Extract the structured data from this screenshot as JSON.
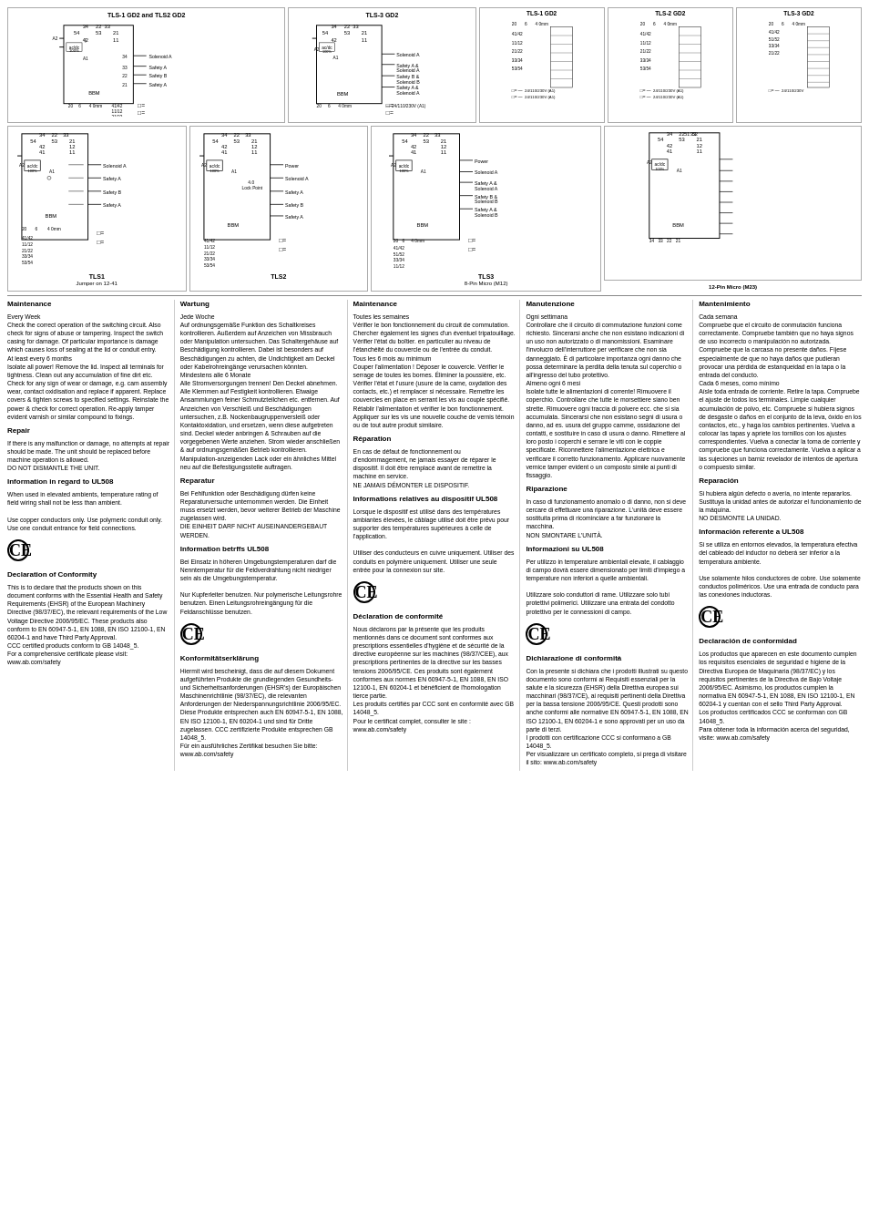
{
  "diagrams": {
    "row1": [
      {
        "label": "TLS-1 GD2 and TLS2 GD2",
        "subtitle": ""
      },
      {
        "label": "TLS-3 GD2",
        "subtitle": ""
      },
      {
        "label": "TLS-1 GD2",
        "subtitle": ""
      },
      {
        "label": "TLS-2 GD2",
        "subtitle": ""
      },
      {
        "label": "TLS-3 GD2",
        "subtitle": ""
      }
    ],
    "row2": [
      {
        "label": "TLS1",
        "subtitle": "Jumper on 12-41"
      },
      {
        "label": "TLS2",
        "subtitle": ""
      },
      {
        "label": "TLS3",
        "subtitle": "8-Pin Micro (M12)"
      },
      {
        "label": "",
        "subtitle": "12-Pin Micro (M23)"
      }
    ]
  },
  "columns": [
    {
      "id": "col1",
      "lang": "EN",
      "sections": [
        {
          "title": "Maintenance",
          "body": "Every Week\nCheck the correct operation of the switching circuit. Also check for signs of abuse or tampering. Inspect the switch casing for damage. Of particular importance is damage which causes loss of sealing at the lid or conduit entry.\nAt least every 6 months\nIsolate all power! Remove the lid. Inspect all terminals for tightness. Clean out any accumulation of fine dirt etc. Check for any sign of wear or damage, e.g. cam assembly wear, contact oxidisation and replace if apparent. Replace covers & tighten screws to specified settings. Reinstate the power & check for correct operation. Re-apply tamper evident varnish or similar compound to fixings."
        },
        {
          "title": "Repair",
          "body": "If there is any malfunction or damage, no attempts at repair should be made. The unit should be replaced before machine operation is allowed.\nDO NOT DISMANTLE THE UNIT."
        },
        {
          "title": "Information in regard to UL508",
          "body": "When used in elevated ambients, temperature rating of field wiring shall not be less than ambient.\n\nUse copper conductors only. Use polymeric conduit only. Use one conduit entrance for field connections."
        },
        {
          "title": "CE",
          "is_ce": true
        },
        {
          "title": "Declaration of Conformity",
          "body": "This is to declare that the products shown on this document conforms with the Essential Health and Safety Requirements (EHSR) of the European Machinery Directive (98/37/EC), the relevant requirements of the Low Voltage Directive 2006/95/EC. These products also conform to EN 60947-5-1, EN 1088, EN ISO 12100-1, EN 60204-1 and have Third Party Approval.\nCCC certified products conform to GB 14048_5.\nFor a comprehensive certificate please visit: www.ab.com/safety"
        }
      ]
    },
    {
      "id": "col2",
      "lang": "DE",
      "sections": [
        {
          "title": "Wartung",
          "body": "Jede Woche\nAuf ordnungsgemäße Funktion des Schaltkreises kontrollieren. Außerdem auf Anzeichen von Missbrauch oder Manipulation untersuchen. Das Schaltergehäuse auf Beschädigung kontrollieren. Dabei ist besonders auf Beschädigungen zu achten, die Undichtigkeit am Deckel oder Kabelrohreingänge verursachen könnten.\nMindestens alle 6 Monate\nAlle Stromversorgungen trennen! Den Deckel abnehmen. Alle Klemmen auf Festigkeit kontrollieren. Etwaige Ansammlungen feiner Schmutzteilchen etc. entfernen. Auf Anzeichen von Verschleiß und Beschädigungen untersuchen, z.B. Nockenbaugruppenversleiß oder Kontaktoxidation, und ersetzen, wenn diese aufgetreten sind. Deckel wieder anbringen & Schrauben auf die vorgegebenen Werte anziehen. Strom wieder anschließen & auf ordnungsgemäßen Betrieb kontrollieren. Manipulation-anzeigenden Lack oder ein ähnliches Mittel neu auf die Befestigungsstelle auftragen."
        },
        {
          "title": "Reparatur",
          "body": "Bei Fehlfunktion oder Beschädigung dürfen keine Reparaturversuche unternommen werden. Die Einheit muss ersetzt werden, bevor weiterer Betrieb der Maschine zugelassen wird.\nDIE EINHEIT DARF NICHT AUSEINANDERGEBAUT WERDEN."
        },
        {
          "title": "Information betrffs UL508",
          "body": "Bei Einsatz in höheren Umgebungstemperaturen darf die Nenntemperatur für die Feldverdrahtung nicht niedriger sein als die Umgebungstemperatur.\n\nNur Kupferleiter benutzen. Nur polymerische Leitungsrohre benutzen. Einen Leitungsrohreingängung für die Feldanschlüsse benutzen."
        },
        {
          "title": "CE",
          "is_ce": true
        },
        {
          "title": "Konformitätserklärung",
          "body": "Hiermit wird bescheinigt, dass die auf diesem Dokument aufgeführten Produkte die grundlegenden Gesundheits- und Sicherheitsanforderungen (EHSR's) der Europäischen Maschinenrichtlinie (98/37/EC), die relevanten Anforderungen der Niederspannungsrichtlinie 2006/95/EC. Diese Produkte entsprechen auch EN 60947-5-1, EN 1088, EN ISO 12100-1, EN 60204-1 und sind für Dritte zugelassen. CCC zertifizierte Produkte entsprechen GB 14048_5.\nFür ein ausführliches Zertifikat besuchen Sie bitte: www.ab.com/safety"
        }
      ]
    },
    {
      "id": "col3",
      "lang": "FR",
      "sections": [
        {
          "title": "Maintenance",
          "body": "Toutes les semaines\nVérifier le bon fonctionnement du circuit de commutation. Chercher également les signes d'un éventuel tripatouillage. Vérifier l'état du boîtier. en particulier au niveau de l'étanchéité du couvercle ou de l'entrée du conduit.\nTous les 6 mois au minimum\nCouper l'alimentation ! Déposer le couvercle. Vérifier le serrage de toutes les bornes. Éliminer la poussière, etc. Vérifier l'état et l'usure (usure de la came, oxydation des contacts, etc.) et remplacer si nécessaire. Remettre les couvercles en place en serrant les vis au couple spécifié. Rétablir l'alimentation et vérifier le bon fonctionnement. Appliquer sur les vis une nouvelle couche de vernis témoin ou de tout autre produit similaire."
        },
        {
          "title": "Réparation",
          "body": "En cas de défaut de fonctionnement ou d'endommagement, ne jamais essayer de réparer le dispositif. Il doit être remplacé avant de remettre la machine en service.\nNE JAMAIS DÉMONTER LE DISPOSITIF."
        },
        {
          "title": "Informations relatives au dispositif UL508",
          "body": "Lorsque le dispositif est utilisé dans des températures ambiantes élevées, le câblage utilisé doit être prévu pour supporter des températures supérieures à celle de l'application.\n\nUtiliser des conducteurs en cuivre uniquement. Utiliser des conduits en polymère uniquement. Utiliser une seule entrée pour la connexion sur site."
        },
        {
          "title": "CE",
          "is_ce": true
        },
        {
          "title": "Déclaration de conformité",
          "body": "Nous déclarons par la présente que les produits mentionnés dans ce document sont conformes aux prescriptions essentielles d'hygiène et de sécurité de la directive européenne sur les machines (98/37/CEE), aux prescriptions pertinentes de la directive sur les basses tensions 2006/95/CE. Ces produits sont également conformes aux normes EN 60947-5-1, EN 1088, EN ISO 12100-1, EN 60204-1 et bénéficient de l'homologation tierce partie.\nLes produits certifiés par CCC sont en conformité avec GB 14048_5.\nPour le certificat complet, consulter le site : www.ab.com/safety"
        }
      ]
    },
    {
      "id": "col4",
      "lang": "IT",
      "sections": [
        {
          "title": "Manutenzione",
          "body": "Ogni settimana\nControllare che il circuito di commutazione funzioni come richiesto. Sincerarsi anche che non esistano indicazioni di un uso non autorizzato o di manomissioni. Esaminare l'involucro dell'interruttore per verificare che non sia danneggiato. È di particolare importanza ogni danno che possa determinare la perdita della tenuta sul coperchio o all'ingresso del tubo protettivo.\nAlmeno ogni 6 mesi\nIsolate tutte le alimentazioni di corrente! Rimuovere il coperchio. Controllare che tutte le morsettiere siano ben strette. Rimuovere ogni traccia di polvere ecc. che si sia accumulata. Sincerarsi che non esistano segni di usura o danno, ad es. usura del gruppo camme, ossidazione dei contatti, e sostituire in caso di usura o danno. Rimettere al loro posto i coperchi e serrare le viti con le coppie specificate. Riconnettere l'alimentazione elettrica e verificare il corretto funzionamento. Applicare nuovamente vernice tamper evident o un composto simile ai punti di fissaggio."
        },
        {
          "title": "Riparazione",
          "body": "In caso di funzionamento anomalo o di danno, non si deve cercare di effettuare una riparazione. L'unità deve essere sostituita prima di ricominciare a far funzionare la macchina.\nNON SMONTARE L'UNITÀ."
        },
        {
          "title": "Informazioni su UL508",
          "body": "Per utilizzo in temperature ambientali elevate, il cablaggio di campo dovrà essere dimensionato per limiti d'impiego a temperature non inferiori a quelle ambientali.\n\nUtilizzare solo conduttori di rame. Utilizzare solo tubi protettivi polimerici. Utilizzare una entrata del condotto protettivo per le connessioni di campo."
        },
        {
          "title": "CE",
          "is_ce": true
        },
        {
          "title": "Dichiarazione di conformità",
          "body": "Con la presente si dichiara che i prodotti illustrati su questo documento sono conformi ai Requisiti essenziali per la salute e la sicurezza (EHSR) della Direttiva europea sui macchinari (98/37/CE), ai requisiti pertinenti della Direttiva per la bassa tensione 2006/95/CE. Questi prodotti sono anche conformi alle normative EN 60947-5-1, EN 1088, EN ISO 12100-1, EN 60204-1 e sono approvati per un uso da parte di terzi.\nI prodotti con certificazione CCC si conformano a GB 14048_5.\nPer visualizzare un certificato completo, si prega di visitare il sito: www.ab.com/safety"
        }
      ]
    },
    {
      "id": "col5",
      "lang": "ES",
      "sections": [
        {
          "title": "Mantenimiento",
          "body": "Cada semana\nCompruebe que el circuito de conmutación funciona correctamente. Compruebe también que no haya signos de uso incorrecto o manipulación no autorizada. Compruebe que la carcasa no presente daños. Fíjese especialmente de que no haya daños que pudieran provocar una pérdida de estanqueidad en la tapa o la entrada del conducto.\nCada 6 meses, como mínimo\nAísle toda entrada de corriente. Retire la tapa. Compruebe el ajuste de todos los terminales. Limpie cualquier acumulación de polvo, etc. Compruebe si hubiera signos de desgaste o daños en el conjunto de la leva, óxido en los contactos, etc., y haga los cambios pertinentes. Vuelva a colocar las tapas y apriete los tornillos con los ajustes correspondientes. Vuelva a conectar la toma de corriente y compruebe que funciona correctamente. Vuelva a aplicar a las sujeciones un barniz revelador de intentos de apertura o compuesto similar."
        },
        {
          "title": "Reparación",
          "body": "Si hubiera algún defecto o avería, no intente repararlos. Sustituya la unidad antes de autorizar el funcionamiento de la máquina.\nNO DESMONTE LA UNIDAD."
        },
        {
          "title": "Información referente a UL508",
          "body": "Si se utiliza en entornos elevados, la temperatura efectiva del cableado del inductor no deberá ser inferior a la temperatura ambiente.\n\nUse solamente hilos conductores de cobre. Use solamente conductos poliméricos. Use una entrada de conducto para las conexiones inductoras."
        },
        {
          "title": "CE",
          "is_ce": true
        },
        {
          "title": "Declaración de conformidad",
          "body": "Los productos que aparecen en este documento cumplen los requisitos esenciales de seguridad e higiene de la Directiva Europea de Maquinaria (98/37/EC) y los requisitos pertinentes de la Directiva de Bajo Voltaje 2006/95/EC. Asimismo, los productos cumplen la normativa EN 60947-5-1, EN 1088, EN ISO 12100-1, EN 60204-1 y cuentan con el sello Third Party Approval.\nLos productos certificados CCC se conforman con GB 14048_5.\nPara obtener toda la información acerca del seguridad, visite: www.ab.com/safety"
        }
      ]
    }
  ],
  "information_label": "Information",
  "informations_relatives_label": "Informations relatives"
}
